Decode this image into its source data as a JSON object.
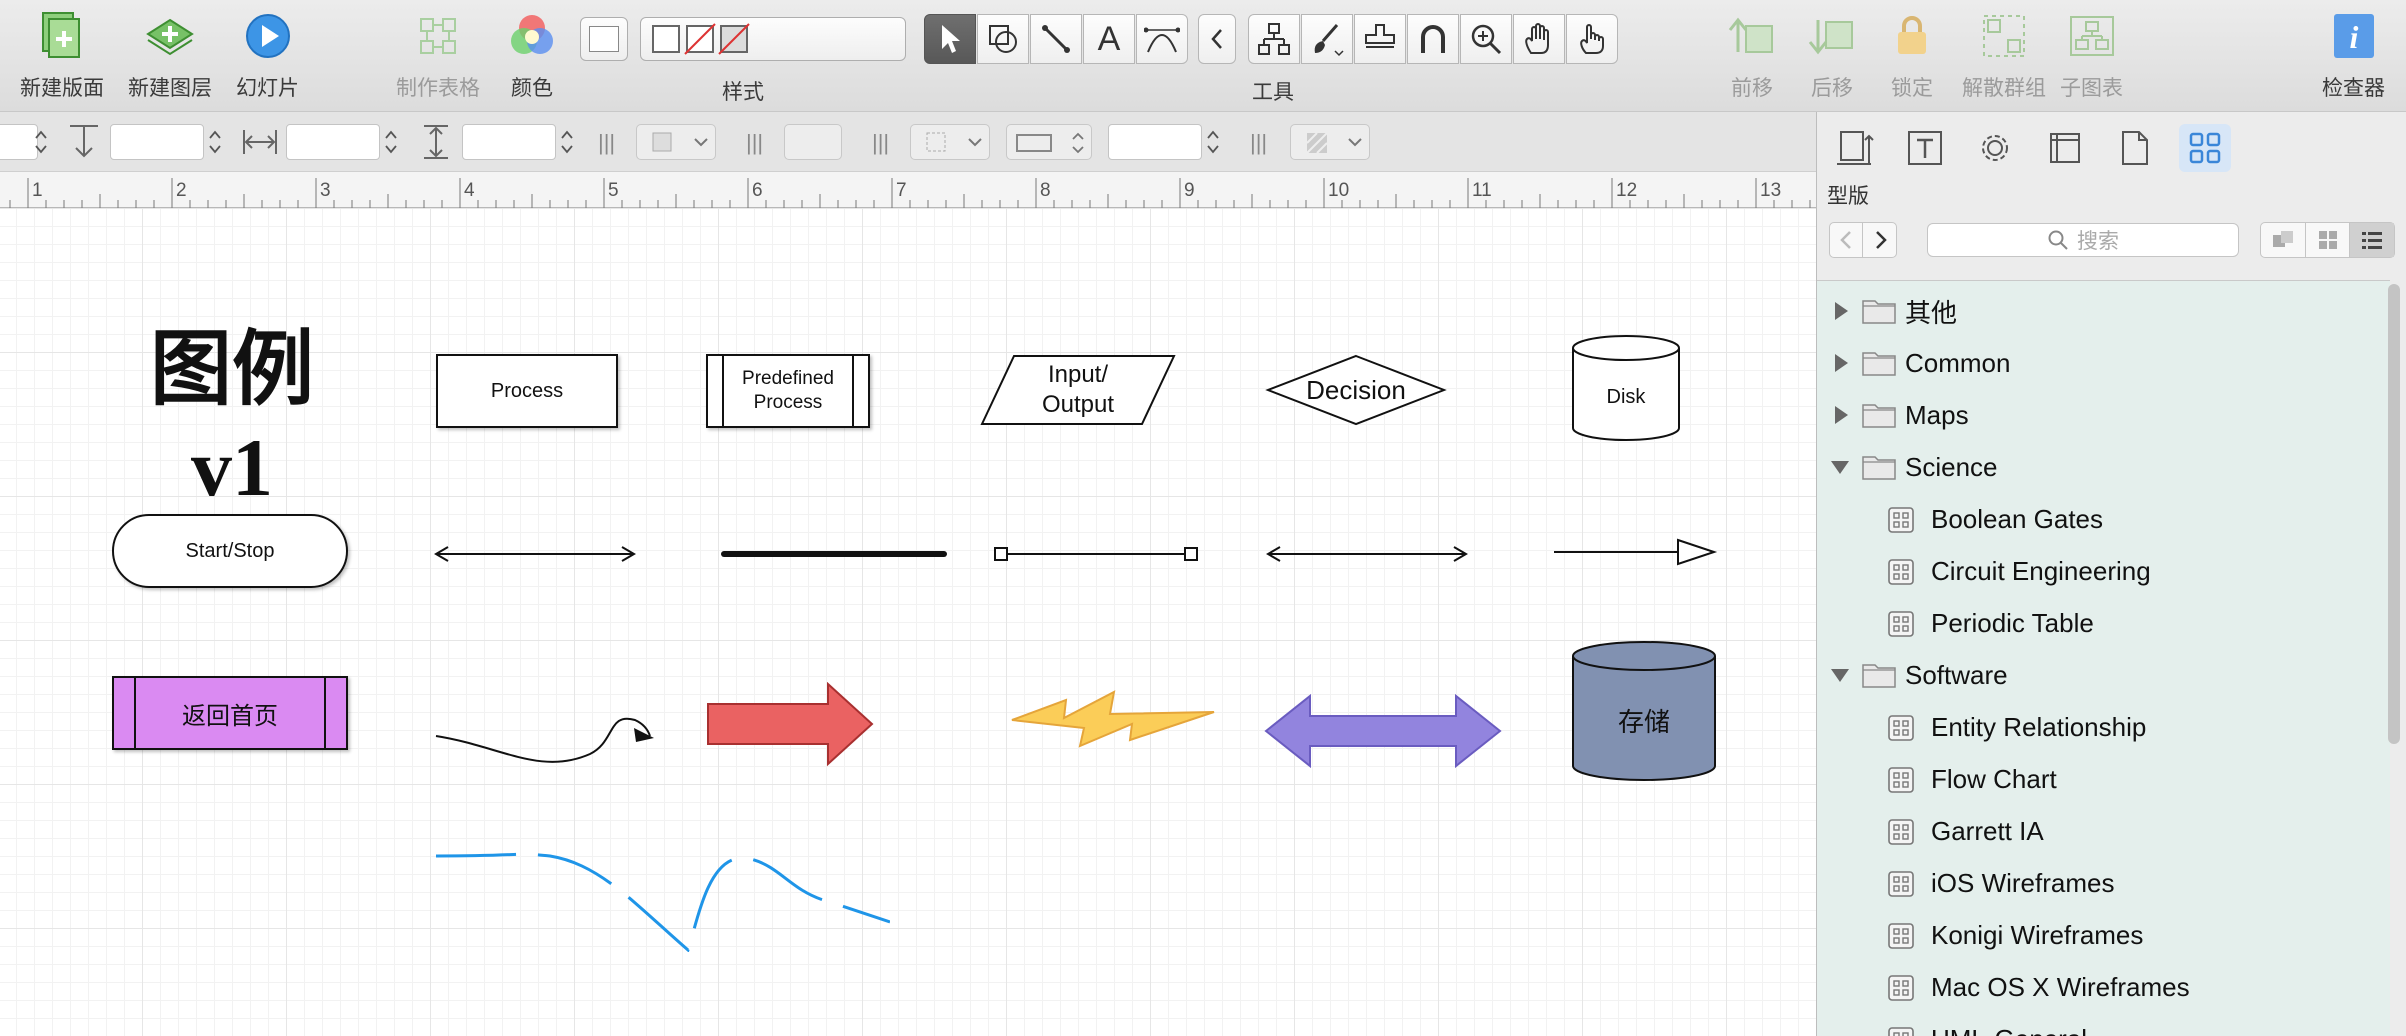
{
  "toolbar": {
    "new_canvas": "新建版面",
    "new_layer": "新建图层",
    "slideshow": "幻灯片",
    "make_table": "制作表格",
    "colors": "颜色",
    "style_label": "样式",
    "tools_label": "工具",
    "bring_forward": "前移",
    "send_backward": "后移",
    "lock": "锁定",
    "ungroup": "解散群组",
    "subgraph": "子图表",
    "inspector": "检查器"
  },
  "canvas": {
    "title": "图例v1",
    "process": "Process",
    "predefined_process": "Predefined\nProcess",
    "input_output": "Input/\nOutput",
    "decision": "Decision",
    "disk": "Disk",
    "start_stop": "Start/Stop",
    "back_home": "返回首页",
    "storage": "存储"
  },
  "ruler": {
    "ticks": [
      "1",
      "2",
      "3",
      "4",
      "5",
      "6",
      "7",
      "8",
      "9",
      "10",
      "11",
      "12",
      "13"
    ]
  },
  "inspector": {
    "section_title": "型版",
    "search_placeholder": "搜索",
    "items": [
      {
        "label": "其他",
        "kind": "folder",
        "expanded": false
      },
      {
        "label": "Common",
        "kind": "folder",
        "expanded": false
      },
      {
        "label": "Maps",
        "kind": "folder",
        "expanded": false
      },
      {
        "label": "Science",
        "kind": "folder",
        "expanded": true
      },
      {
        "label": "Boolean Gates",
        "kind": "stencil"
      },
      {
        "label": "Circuit Engineering",
        "kind": "stencil"
      },
      {
        "label": "Periodic Table",
        "kind": "stencil"
      },
      {
        "label": "Software",
        "kind": "folder",
        "expanded": true
      },
      {
        "label": "Entity Relationship",
        "kind": "stencil"
      },
      {
        "label": "Flow Chart",
        "kind": "stencil"
      },
      {
        "label": "Garrett IA",
        "kind": "stencil"
      },
      {
        "label": "iOS Wireframes",
        "kind": "stencil"
      },
      {
        "label": "Konigi Wireframes",
        "kind": "stencil"
      },
      {
        "label": "Mac OS X Wireframes",
        "kind": "stencil"
      },
      {
        "label": "UML-General",
        "kind": "stencil"
      }
    ]
  },
  "colors": {
    "purple_fill": "#da8af2",
    "red_arrow": "#ea6262",
    "blue_double_arrow": "#9284de",
    "storage_fill": "#8191b1",
    "dashed_line": "#1f95e8",
    "list_bg": "#e4efec",
    "selected_tab": "#d7e6f7"
  }
}
